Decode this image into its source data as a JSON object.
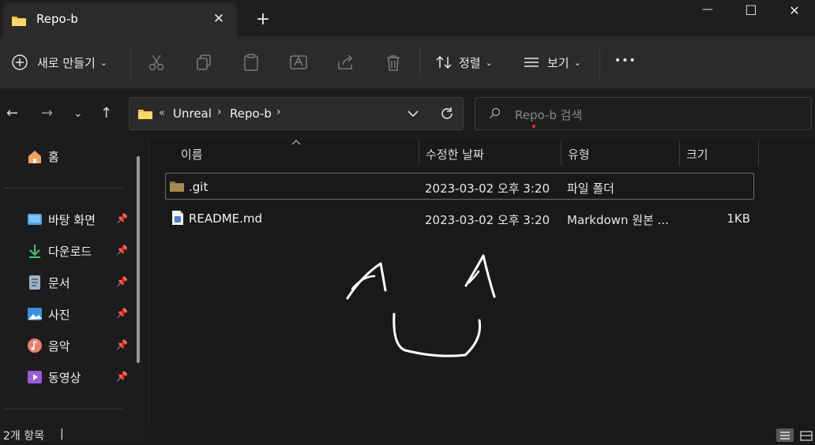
{
  "window": {
    "tab_title": "Repo-b",
    "tab_close": "✕",
    "new_tab": "+",
    "minimize": "—",
    "maximize": "☐",
    "close": "✕"
  },
  "toolbar": {
    "new_label": "새로 만들기",
    "sort_label": "정렬",
    "view_label": "보기",
    "more_label": "•••"
  },
  "address": {
    "overflow": "«",
    "crumbs": [
      "Unreal",
      "Repo-b"
    ],
    "search_placeholder": "Repo-b 검색"
  },
  "sidebar": {
    "home_label": "홈",
    "items": [
      {
        "label": "바탕 화면",
        "icon": "desktop-icon"
      },
      {
        "label": "다운로드",
        "icon": "download-icon"
      },
      {
        "label": "문서",
        "icon": "document-icon"
      },
      {
        "label": "사진",
        "icon": "pictures-icon"
      },
      {
        "label": "음악",
        "icon": "music-icon"
      },
      {
        "label": "동영상",
        "icon": "video-icon"
      }
    ]
  },
  "columns": [
    "이름",
    "수정한 날짜",
    "유형",
    "크기"
  ],
  "files": [
    {
      "name": ".git",
      "date": "2023-03-02 오후 3:20",
      "type": "파일 폴더",
      "size": "",
      "icon": "folder-icon"
    },
    {
      "name": "README.md",
      "date": "2023-03-02 오후 3:20",
      "type": "Markdown 원본 ...",
      "size": "1KB",
      "icon": "markdown-file-icon"
    }
  ],
  "status": {
    "count": "2개 항목"
  },
  "colors": {
    "background": "#191919",
    "folder": "#f3c14c",
    "accent": "#4ea3e6"
  }
}
